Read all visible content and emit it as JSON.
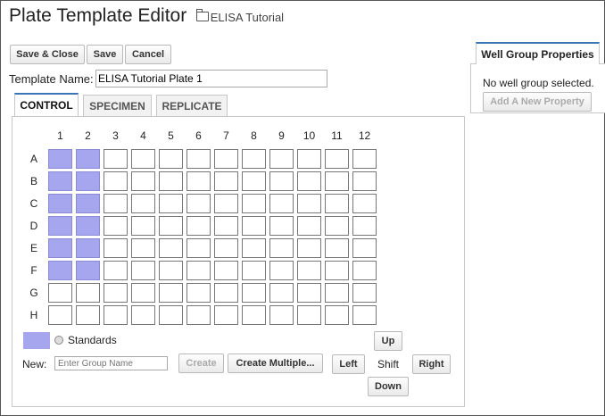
{
  "header": {
    "title": "Plate Template Editor",
    "breadcrumb": "ELISA Tutorial",
    "breadcrumb_icon": "folder-icon"
  },
  "toolbar": {
    "save_close_label": "Save & Close",
    "save_label": "Save",
    "cancel_label": "Cancel"
  },
  "template": {
    "name_label": "Template Name:",
    "name_value": "ELISA Tutorial Plate 1"
  },
  "tabs": [
    {
      "label": "CONTROL",
      "active": true
    },
    {
      "label": "SPECIMEN",
      "active": false
    },
    {
      "label": "REPLICATE",
      "active": false
    }
  ],
  "plate": {
    "columns": [
      "1",
      "2",
      "3",
      "4",
      "5",
      "6",
      "7",
      "8",
      "9",
      "10",
      "11",
      "12"
    ],
    "rows": [
      "A",
      "B",
      "C",
      "D",
      "E",
      "F",
      "G",
      "H"
    ],
    "filled_color": "#a6a6ee",
    "filled_wells": [
      "A1",
      "A2",
      "B1",
      "B2",
      "C1",
      "C2",
      "D1",
      "D2",
      "E1",
      "E2",
      "F1",
      "F2"
    ]
  },
  "legend": {
    "group_name": "Standards",
    "color": "#a6a6ee"
  },
  "new_group": {
    "label": "New:",
    "placeholder": "Enter Group Name",
    "create_label": "Create",
    "create_multiple_label": "Create Multiple..."
  },
  "shift": {
    "label": "Shift",
    "up": "Up",
    "down": "Down",
    "left": "Left",
    "right": "Right"
  },
  "properties": {
    "tab_label": "Well Group Properties",
    "empty_text": "No well group selected.",
    "add_label": "Add A New Property"
  },
  "colors": {
    "accent": "#3a76b7"
  }
}
